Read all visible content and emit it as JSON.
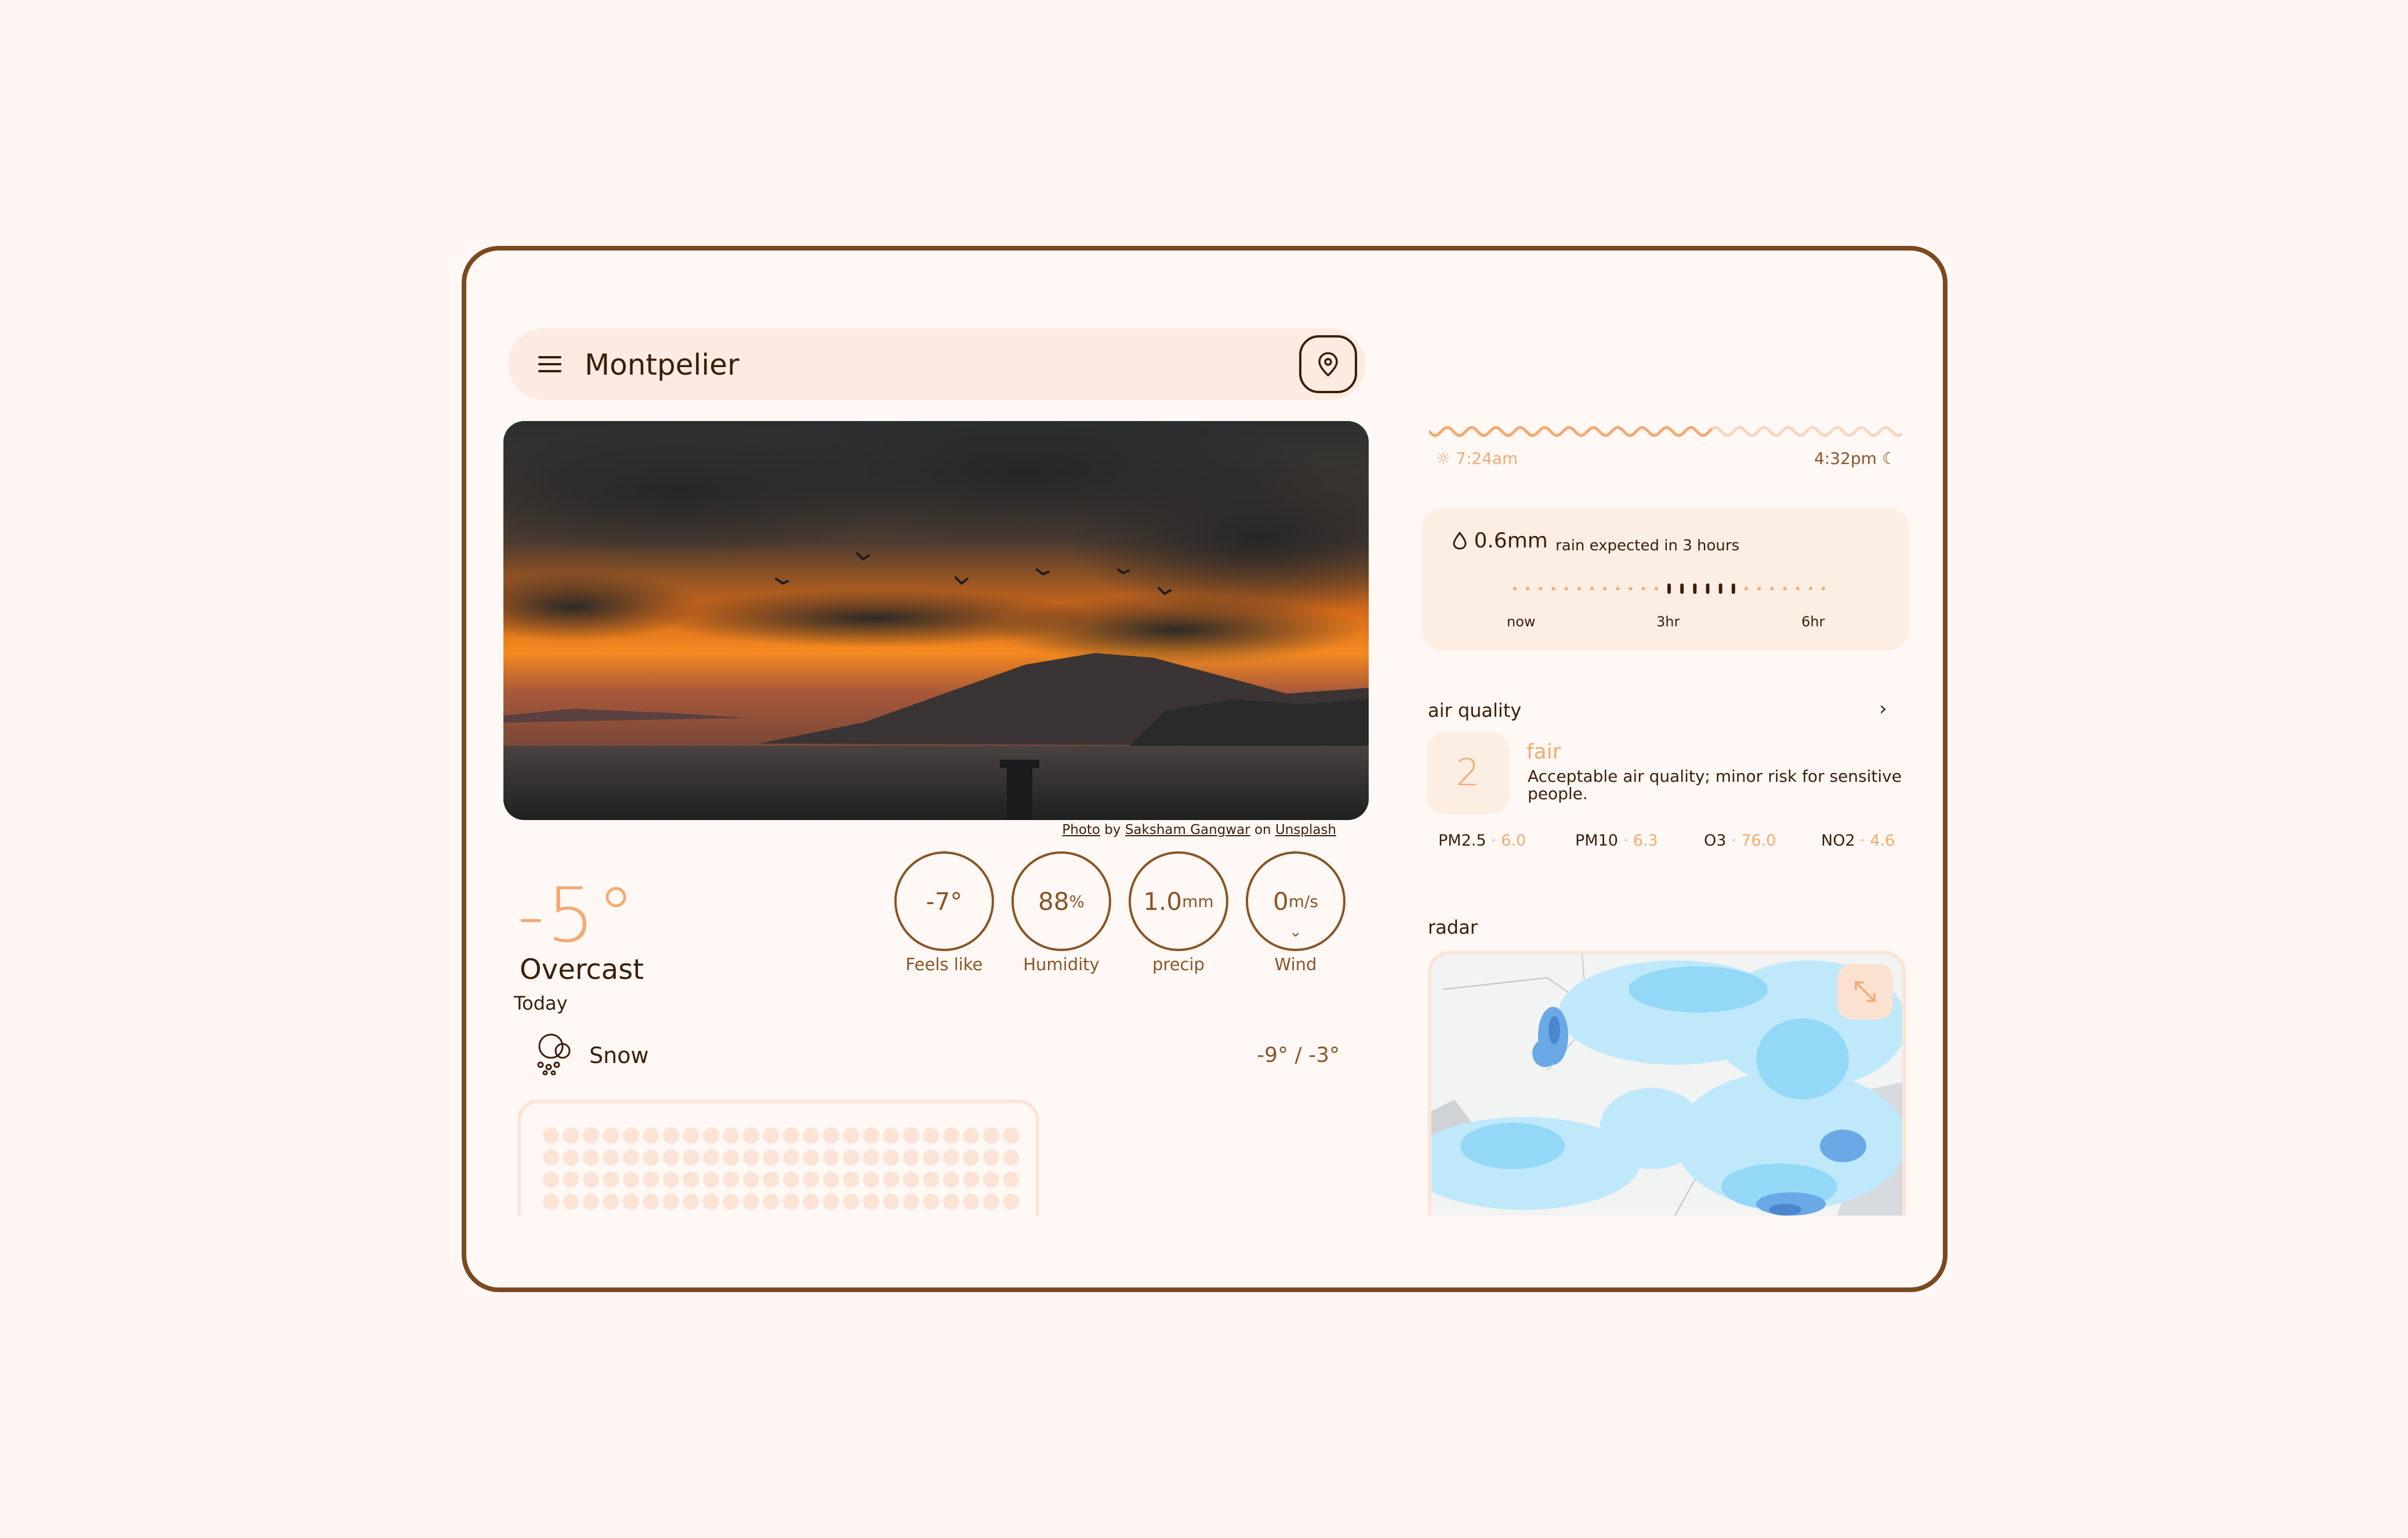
{
  "search": {
    "city": "Montpelier",
    "menu_icon": "menu-icon",
    "location_icon": "map-pin-icon"
  },
  "photo": {
    "credit_prefix": "Photo",
    "credit_by": "by",
    "credit_author": "Saksham Gangwar",
    "credit_on": "on",
    "credit_source": "Unsplash"
  },
  "current": {
    "temperature": "-5°",
    "condition": "Overcast",
    "day_label": "Today"
  },
  "stats": {
    "feels_like": {
      "value": "-7°",
      "unit": "",
      "label": "Feels like"
    },
    "humidity": {
      "value": "88",
      "unit": "%",
      "label": "Humidity"
    },
    "precip": {
      "value": "1.0",
      "unit": "mm",
      "label": "precip"
    },
    "wind": {
      "value": "0",
      "unit": "m/s",
      "label": "Wind"
    }
  },
  "forecast": {
    "label": "Snow",
    "range": "-9° / -3°",
    "icon": "snow-icon"
  },
  "sun": {
    "sunrise": "7:24am",
    "sunset": "4:32pm",
    "day_progress": 0.6
  },
  "rain": {
    "amount": "0.6mm",
    "message": "rain expected in 3 hours",
    "ticks": [
      "now",
      "3hr",
      "6hr"
    ]
  },
  "air_quality": {
    "title": "air quality",
    "index": "2",
    "level": "fair",
    "description": "Acceptable air quality; minor risk for sensitive people.",
    "pollutants": [
      {
        "name": "PM2.5",
        "value": "6.0"
      },
      {
        "name": "PM10",
        "value": "6.3"
      },
      {
        "name": "O3",
        "value": "76.0"
      },
      {
        "name": "NO2",
        "value": "4.6"
      }
    ]
  },
  "radar": {
    "title": "radar"
  },
  "colors": {
    "accent": "#f4aa70",
    "brown": "#7a4a1e",
    "card": "#fdeee4",
    "background": "#fff7f3"
  }
}
